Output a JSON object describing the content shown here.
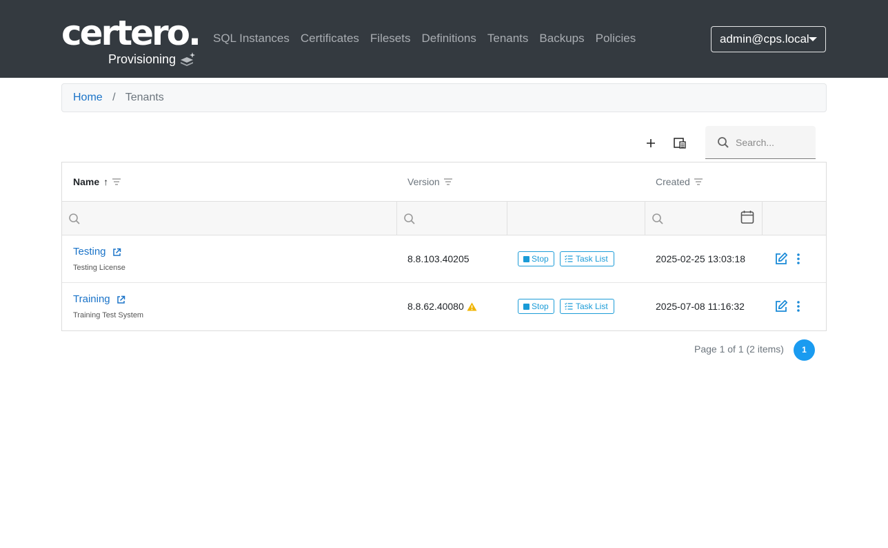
{
  "brand": {
    "logo": "certero.",
    "subtitle": "Provisioning"
  },
  "nav": {
    "items": [
      {
        "label": "SQL Instances"
      },
      {
        "label": "Certificates"
      },
      {
        "label": "Filesets"
      },
      {
        "label": "Definitions"
      },
      {
        "label": "Tenants"
      },
      {
        "label": "Backups"
      },
      {
        "label": "Policies"
      }
    ],
    "user": "admin@cps.local"
  },
  "breadcrumb": {
    "home": "Home",
    "separator": "/",
    "current": "Tenants"
  },
  "toolbar": {
    "search_placeholder": "Search..."
  },
  "grid": {
    "columns": {
      "name": "Name",
      "version": "Version",
      "created": "Created"
    },
    "sort": {
      "column": "Name",
      "direction": "ascending",
      "arrow": "↑"
    },
    "rows": [
      {
        "name": "Testing",
        "description": "Testing License",
        "version": "8.8.103.40205",
        "version_warning": false,
        "stop_label": "Stop",
        "tasks_label": "Task List",
        "created": "2025-02-25 13:03:18"
      },
      {
        "name": "Training",
        "description": "Training Test System",
        "version": "8.8.62.40080",
        "version_warning": true,
        "stop_label": "Stop",
        "tasks_label": "Task List",
        "created": "2025-07-08 11:16:32"
      }
    ]
  },
  "pager": {
    "info": "Page 1 of 1 (2 items)",
    "current_page": "1"
  },
  "colors": {
    "header_bg": "#343a40",
    "link": "#1a73c8",
    "accent": "#1a9bd7",
    "page_active": "#1a9bf0",
    "warning": "#f0b400"
  }
}
